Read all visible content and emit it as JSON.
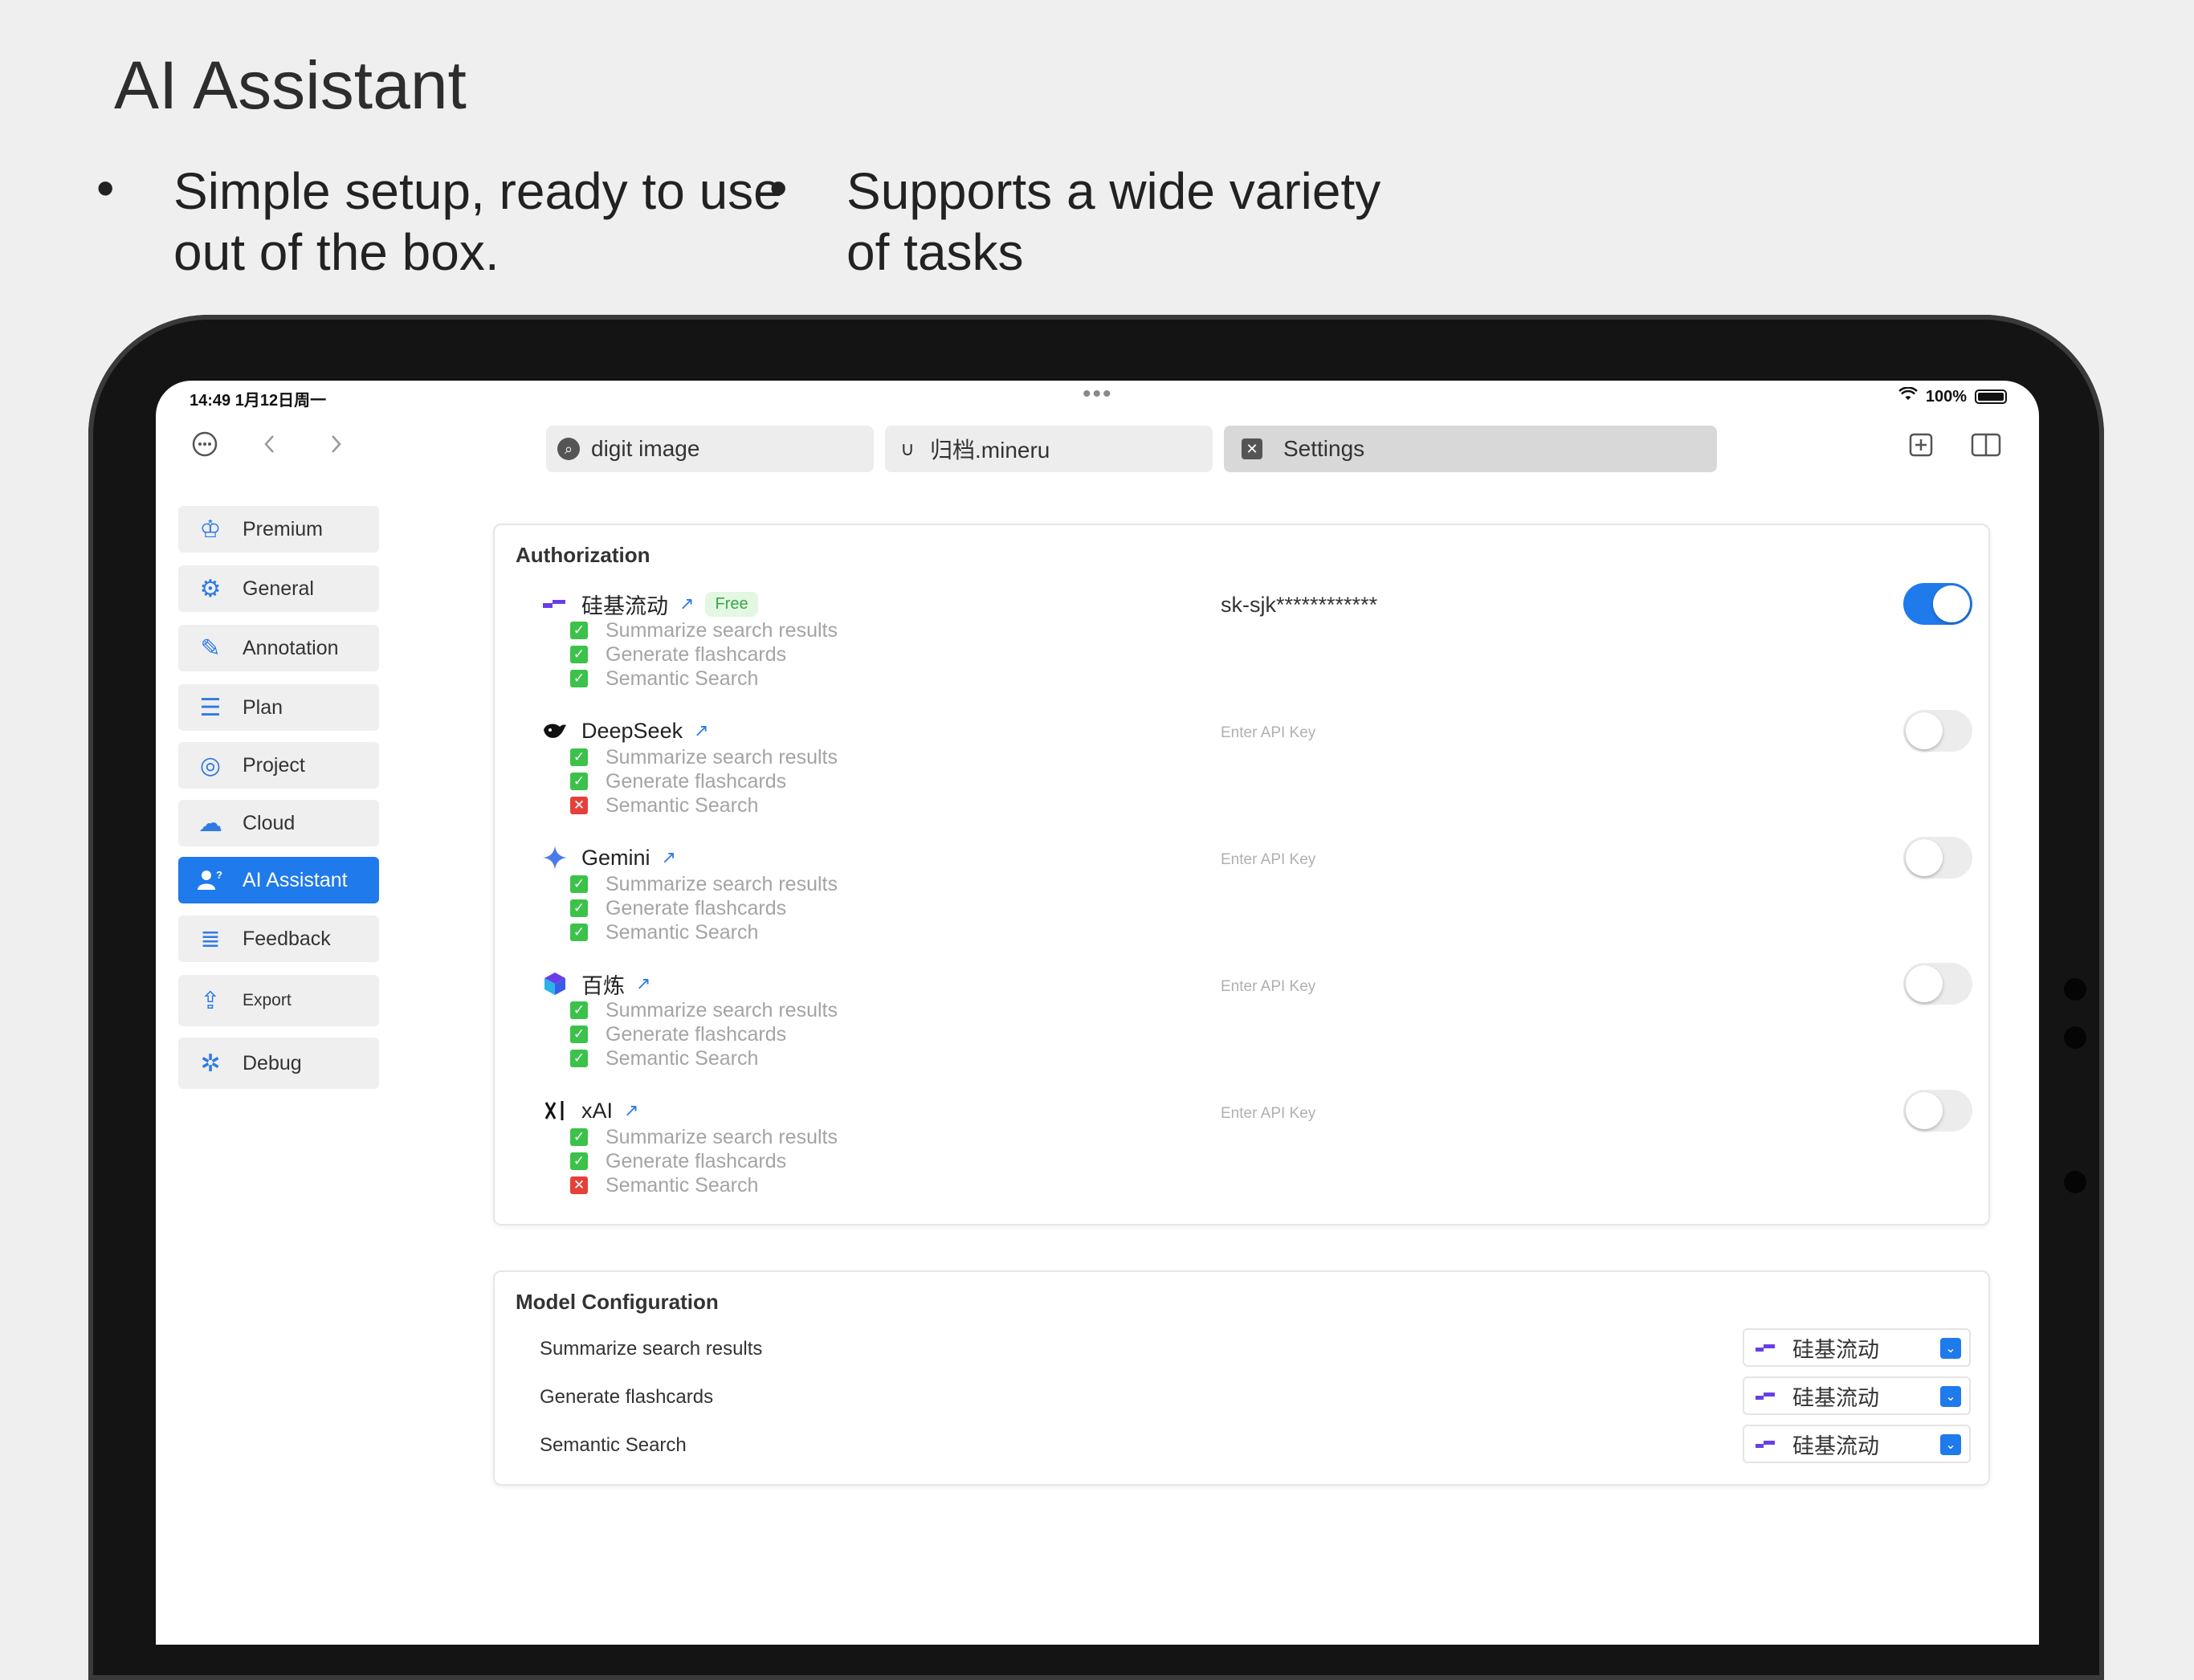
{
  "promo": {
    "title": "AI Assistant",
    "bullets": [
      {
        "dot": "•",
        "text": "Simple setup, ready to use\nout of the box."
      },
      {
        "dot": "•",
        "text": "Supports a wide variety\nof tasks"
      }
    ]
  },
  "status_bar": {
    "time": "14:49  1月12日周一",
    "center_dots": "•••",
    "wifi_icon": "wifi-icon",
    "battery": "100%"
  },
  "nav": {
    "menu_icon": "ellipsis-circle-icon",
    "back_icon": "chevron-left-icon",
    "forward_icon": "chevron-right-icon",
    "new_tab_icon": "plus-square-icon",
    "split_view_icon": "sidebar-icon"
  },
  "tabs": [
    {
      "label": "digit image",
      "icon": "search-icon",
      "icon_char": "⌕",
      "active": false
    },
    {
      "label": "归档.mineru",
      "icon": "magnet-icon",
      "icon_char": "∪",
      "active": false
    },
    {
      "label": "Settings",
      "icon": "close-icon",
      "icon_char": "✕",
      "active": true
    }
  ],
  "sidebar": {
    "items": [
      {
        "label": "Premium",
        "icon": "crown-icon",
        "icon_char": "♔"
      },
      {
        "label": "General",
        "icon": "gear-icon",
        "icon_char": "⚙"
      },
      {
        "label": "Annotation",
        "icon": "pencil-icon",
        "icon_char": "✎"
      },
      {
        "label": "Plan",
        "icon": "list-icon",
        "icon_char": "☰"
      },
      {
        "label": "Project",
        "icon": "target-icon",
        "icon_char": "◎"
      },
      {
        "label": "Cloud",
        "icon": "cloud-icon",
        "icon_char": "☁"
      },
      {
        "label": "AI Assistant",
        "icon": "person-question-icon",
        "icon_char": "👤",
        "active": true
      },
      {
        "label": "Feedback",
        "icon": "database-icon",
        "icon_char": "≣"
      },
      {
        "label": "Export",
        "icon": "share-icon",
        "icon_char": "⇪"
      },
      {
        "label": "Debug",
        "icon": "bug-icon",
        "icon_char": "✲"
      }
    ]
  },
  "authorization": {
    "title": "Authorization",
    "providers": [
      {
        "name": "硅基流动",
        "link_icon": "↗",
        "badge": "Free",
        "api_key": "sk-sjk************",
        "enabled": true,
        "logo": "siliconflow-logo-icon",
        "logo_char": "▬",
        "tasks": [
          {
            "label": "Summarize search results",
            "ok": true
          },
          {
            "label": "Generate flashcards",
            "ok": true
          },
          {
            "label": "Semantic Search",
            "ok": true
          }
        ]
      },
      {
        "name": "DeepSeek",
        "link_icon": "↗",
        "badge": "",
        "api_key": "Enter API Key",
        "enabled": false,
        "logo": "deepseek-whale-icon",
        "logo_char": "🐳",
        "tasks": [
          {
            "label": "Summarize search results",
            "ok": true
          },
          {
            "label": "Generate flashcards",
            "ok": true
          },
          {
            "label": "Semantic Search",
            "ok": false
          }
        ]
      },
      {
        "name": "Gemini",
        "link_icon": "↗",
        "badge": "",
        "api_key": "Enter API Key",
        "enabled": false,
        "logo": "gemini-sparkle-icon",
        "logo_char": "✦",
        "tasks": [
          {
            "label": "Summarize search results",
            "ok": true
          },
          {
            "label": "Generate flashcards",
            "ok": true
          },
          {
            "label": "Semantic Search",
            "ok": true
          }
        ]
      },
      {
        "name": "百炼",
        "link_icon": "↗",
        "badge": "",
        "api_key": "Enter API Key",
        "enabled": false,
        "logo": "bailian-cube-icon",
        "logo_char": "⬢",
        "tasks": [
          {
            "label": "Summarize search results",
            "ok": true
          },
          {
            "label": "Generate flashcards",
            "ok": true
          },
          {
            "label": "Semantic Search",
            "ok": true
          }
        ]
      },
      {
        "name": "xAI",
        "link_icon": "↗",
        "badge": "",
        "api_key": "Enter API Key",
        "enabled": false,
        "logo": "xai-logo-icon",
        "logo_char": "𝕏",
        "tasks": [
          {
            "label": "Summarize search results",
            "ok": true
          },
          {
            "label": "Generate flashcards",
            "ok": true
          },
          {
            "label": "Semantic Search",
            "ok": false
          }
        ]
      }
    ]
  },
  "model_configuration": {
    "title": "Model Configuration",
    "rows": [
      {
        "label": "Summarize search results",
        "selected": "硅基流动"
      },
      {
        "label": "Generate flashcards",
        "selected": "硅基流动"
      },
      {
        "label": "Semantic Search",
        "selected": "硅基流动"
      }
    ]
  },
  "colors": {
    "accent": "#1f7aeb",
    "check_ok": "#3cc24a",
    "check_fail": "#e5413a",
    "free_badge": "#3aa648"
  }
}
